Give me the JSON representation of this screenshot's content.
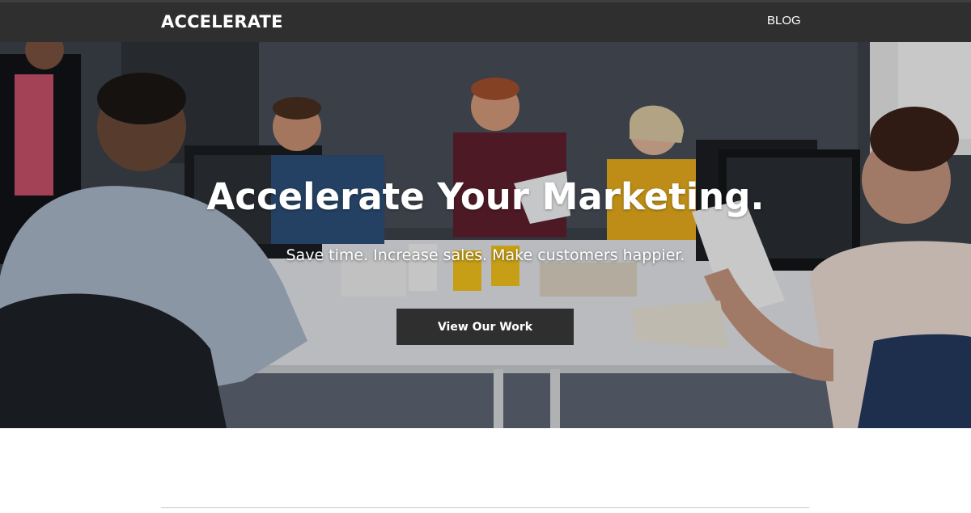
{
  "nav": {
    "brand": "ACCELERATE",
    "links": [
      {
        "label": "BLOG"
      }
    ]
  },
  "hero": {
    "title": "Accelerate Your Marketing.",
    "subtitle": "Save time. Increase sales. Make customers happier.",
    "cta_label": "View Our Work",
    "image_alt": "team working at a shared desk in an office"
  },
  "colors": {
    "nav_bg": "#2f2f2f",
    "button_bg": "#2f2f2f",
    "text_on_dark": "#ffffff",
    "page_bg": "#ffffff",
    "divider": "#c8c8c8"
  }
}
